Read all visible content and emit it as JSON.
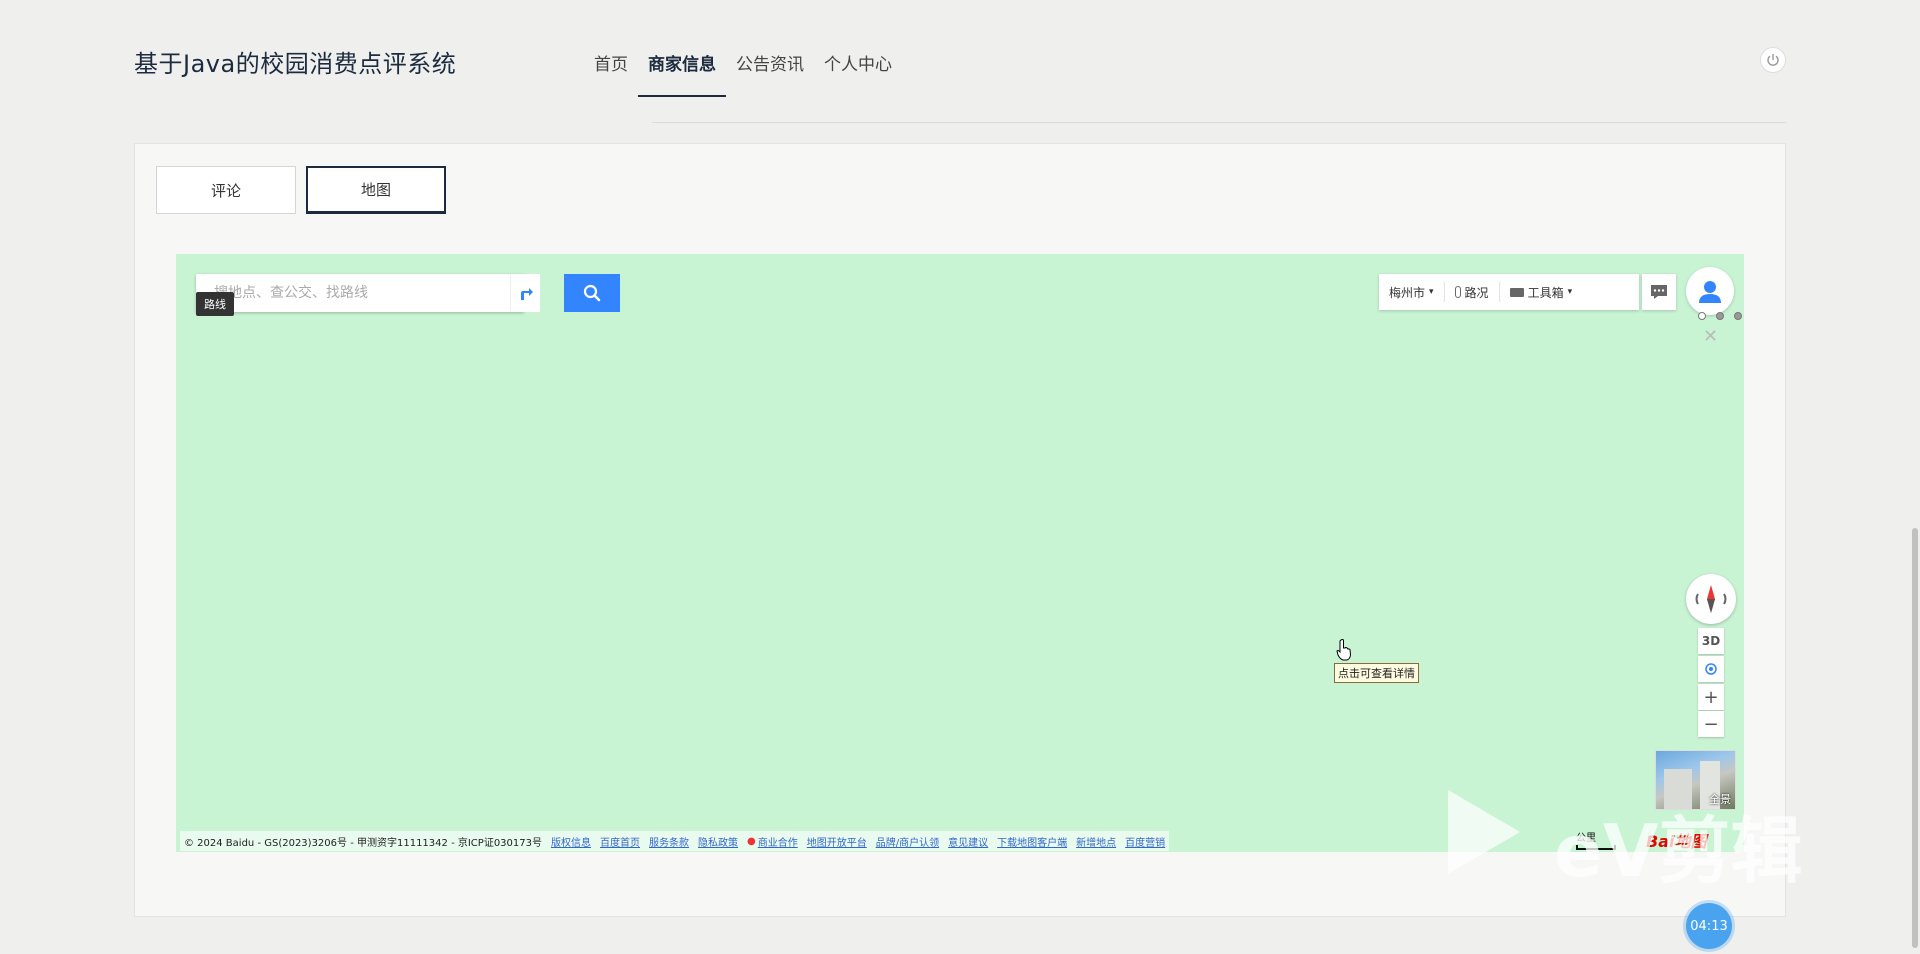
{
  "header": {
    "site_title": "基于Java的校园消费点评系统",
    "nav": [
      {
        "label": "首页",
        "active": false
      },
      {
        "label": "商家信息",
        "active": true
      },
      {
        "label": "公告资讯",
        "active": false
      },
      {
        "label": "个人中心",
        "active": false
      }
    ],
    "power_icon": "power-icon"
  },
  "tabs": [
    {
      "label": "评论",
      "active": false
    },
    {
      "label": "地图",
      "active": true
    }
  ],
  "map": {
    "search_placeholder": "搜地点、查公交、找路线",
    "route_tooltip": "路线",
    "toolbar": {
      "city": "梅州市",
      "traffic": "路况",
      "toolbox": "工具箱"
    },
    "controls": {
      "three_d": "3D",
      "zoom_in": "+",
      "zoom_out": "−"
    },
    "panorama_label": "全景",
    "hover_tooltip": "点击可查看详情",
    "copyright": "© 2024 Baidu - GS(2023)3206号 - 甲测资字11111342 - 京ICP证030173号",
    "footer_links": [
      "版权信息",
      "百度首页",
      "服务条款",
      "隐私政策",
      "商业合作",
      "地图开放平台",
      "品牌/商户认领",
      "意见建议",
      "下载地图客户端",
      "新增地点",
      "百度营销"
    ],
    "scale": "公里",
    "logo": "Bai地图",
    "colors": {
      "map_bg": "#c9f4d4",
      "search_btn": "#3385ff"
    }
  },
  "overlay": {
    "watermark": "eV剪辑",
    "timer": "04:13"
  }
}
